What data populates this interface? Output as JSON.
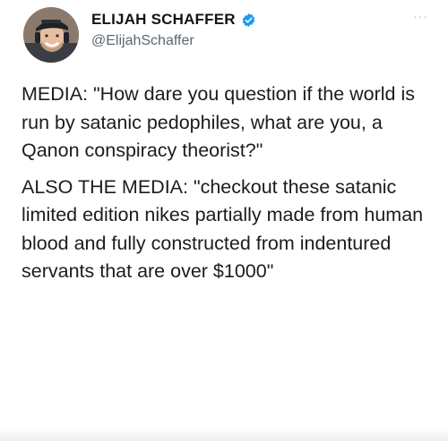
{
  "tweet": {
    "author": {
      "display_name": "ELIJAH SCHAFFER",
      "handle": "@ElijahSchaffer",
      "verified": true,
      "avatar_icon": "profile-photo"
    },
    "more_label": "···",
    "paragraphs": [
      "MEDIA: \"How dare you question if the world is run by satanic pedophiles, what are you, a Qanon conspiracy theorist?\"",
      "ALSO THE MEDIA: \"checkout these satanic limited edition nikes partially made from human blood and fully constructed from indentured servants that are over $1000\""
    ]
  },
  "colors": {
    "verified_badge": "#1d9bf0",
    "text": "#1c1c1c",
    "handle": "#5b6670"
  }
}
